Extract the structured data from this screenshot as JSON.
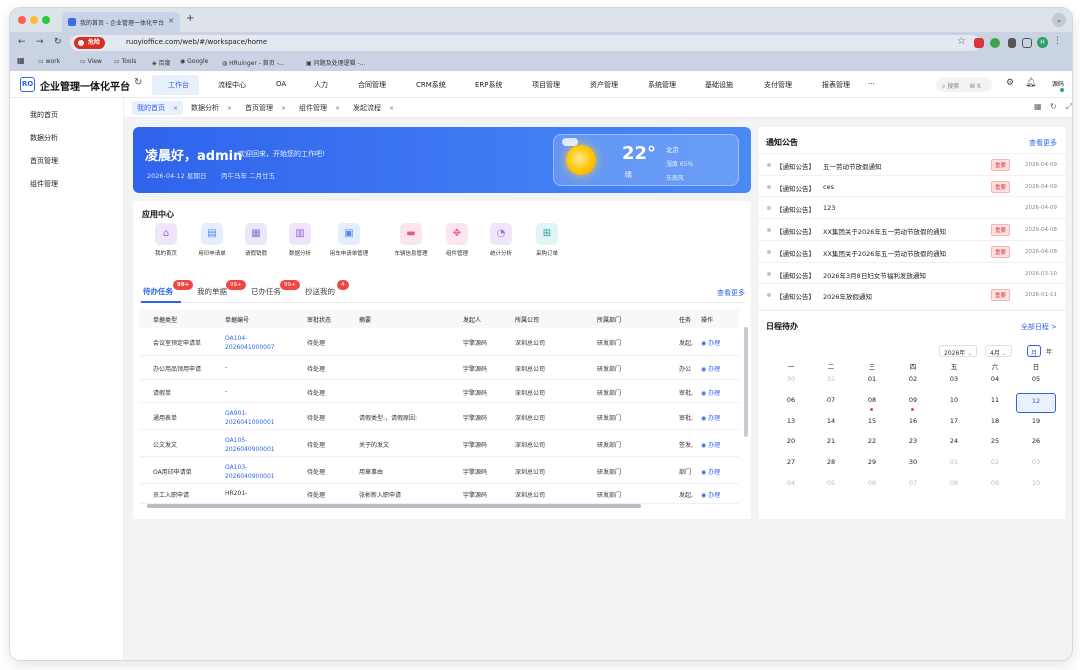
{
  "browser": {
    "tab_title": "我的首页 - 企业管理一体化平台",
    "danger_label": "危险",
    "url": "ruoyioffice.com/web/#/workspace/home",
    "profile_initial": "H",
    "bookmarks": [
      "work",
      "View",
      "Tools",
      "百度",
      "Google",
      "HRuinger - 首页 -...",
      "问题及处理逻辑 -..."
    ]
  },
  "app": {
    "logo": "RO",
    "title": "企业管理一体化平台",
    "nav": [
      "工作台",
      "流程中心",
      "OA",
      "人力",
      "合同管理",
      "CRM系统",
      "ERP系统",
      "项目管理",
      "资产管理",
      "系统管理",
      "基础设施",
      "支付管理",
      "报表管理",
      "···"
    ],
    "search_placeholder": "搜索",
    "search_shortcut": "⌘ K",
    "user": "源码"
  },
  "sidebar": [
    "我的首页",
    "数据分析",
    "首页管理",
    "组件管理"
  ],
  "page_tabs": [
    "我的首页",
    "数据分析",
    "首页管理",
    "组件管理",
    "发起流程"
  ],
  "welcome": {
    "greeting": "凌晨好，admin",
    "message": "欢迎回来，开始您的工作吧!",
    "date": "2026-04-12 星期日",
    "lunar": "丙午马年 二月廿五",
    "temperature": "22°",
    "condition": "晴",
    "city": "北京",
    "humidity": "湿度 65%",
    "wind": "东南风"
  },
  "app_center": {
    "title": "应用中心",
    "items": [
      {
        "label": "我的首页",
        "icon": "home-icon",
        "color": "#9b6be0",
        "bg": "#efe6fb"
      },
      {
        "label": "用印申请单",
        "icon": "document-icon",
        "color": "#4f8ef0",
        "bg": "#e4eefd"
      },
      {
        "label": "请假销假",
        "icon": "calendar-icon",
        "color": "#8b6ed8",
        "bg": "#ece7fa"
      },
      {
        "label": "数据分析",
        "icon": "chart-icon",
        "color": "#9b5fd8",
        "bg": "#efe5fa"
      },
      {
        "label": "用车申请单管理",
        "icon": "form-icon",
        "color": "#4f8ef0",
        "bg": "#e4eefd"
      },
      {
        "label": "车辆信息管理",
        "icon": "car-icon",
        "color": "#e15b8c",
        "bg": "#fce6ee"
      },
      {
        "label": "组件管理",
        "icon": "component-icon",
        "color": "#e2589a",
        "bg": "#fce5f0"
      },
      {
        "label": "统计分析",
        "icon": "pie-icon",
        "color": "#9b6be0",
        "bg": "#efe6fb"
      },
      {
        "label": "采购订单",
        "icon": "grid-icon",
        "color": "#1f9f9a",
        "bg": "#e2f5f4"
      }
    ]
  },
  "tasks": {
    "tabs": [
      {
        "label": "待办任务",
        "badge": "99+"
      },
      {
        "label": "我的单据",
        "badge": "99+"
      },
      {
        "label": "已办任务",
        "badge": "99+"
      },
      {
        "label": "抄送我的",
        "badge": "4"
      }
    ],
    "view_more": "查看更多",
    "columns": [
      "单据类型",
      "单据编号",
      "审批状态",
      "摘要",
      "发起人",
      "所属公司",
      "所属部门",
      "任务",
      "操作"
    ],
    "rows": [
      {
        "type": "会议室预定申请单",
        "no1": "OA104-",
        "no2": "2026041000007",
        "status": "待处理",
        "summary": "",
        "initiator": "宇擎源码",
        "company": "深圳总公司",
        "dept": "研发部门",
        "task": "发起,",
        "op": "◉ 办理"
      },
      {
        "type": "办公用品领用申请",
        "no1": "-",
        "no2": "",
        "status": "待处理",
        "summary": "",
        "initiator": "宇擎源码",
        "company": "深圳总公司",
        "dept": "研发部门",
        "task": "办公",
        "op": "◉ 办理"
      },
      {
        "type": "请假单",
        "no1": "-",
        "no2": "",
        "status": "待处理",
        "summary": "",
        "initiator": "宇擎源码",
        "company": "深圳总公司",
        "dept": "研发部门",
        "task": "审批,",
        "op": "◉ 办理"
      },
      {
        "type": "通用表单",
        "no1": "OA901-",
        "no2": "2026041000001",
        "status": "待处理",
        "summary": "请假类型:，请假原因:",
        "initiator": "宇擎源码",
        "company": "深圳总公司",
        "dept": "研发部门",
        "task": "审批,",
        "op": "◉ 办理"
      },
      {
        "type": "公文发文",
        "no1": "OA105-",
        "no2": "2026040900001",
        "status": "待处理",
        "summary": "关于的发文",
        "initiator": "宇擎源码",
        "company": "深圳总公司",
        "dept": "研发部门",
        "task": "签发,",
        "op": "◉ 办理"
      },
      {
        "type": "OA用印申请单",
        "no1": "OA103-",
        "no2": "2026040900001",
        "status": "待处理",
        "summary": "用章事由",
        "initiator": "宇擎源码",
        "company": "深圳总公司",
        "dept": "研发部门",
        "task": "部门",
        "op": "◉ 办理"
      },
      {
        "type": "员工入职申请",
        "no1": "HR201-",
        "no2": "",
        "status": "待处理",
        "summary": "张彬新入职申请",
        "initiator": "宇擎源码",
        "company": "深圳总公司",
        "dept": "研发部门",
        "task": "发起,",
        "op": "◉ 办理"
      }
    ]
  },
  "notices": {
    "title": "通知公告",
    "view_more": "查看更多",
    "items": [
      {
        "category": "【通知公告】",
        "text": "五一劳动节放假通知",
        "important": "重要",
        "date": "2026-04-09"
      },
      {
        "category": "【通知公告】",
        "text": "ces",
        "important": "重要",
        "date": "2026-04-09"
      },
      {
        "category": "【通知公告】",
        "text": "123",
        "important": "",
        "date": "2026-04-09"
      },
      {
        "category": "【通知公告】",
        "text": "XX集团关于2026年五一劳动节放假的通知",
        "important": "重要",
        "date": "2026-04-08"
      },
      {
        "category": "【通知公告】",
        "text": "XX集团关于2026年五一劳动节放假的通知",
        "important": "重要",
        "date": "2026-04-08"
      },
      {
        "category": "【通知公告】",
        "text": "2026年3月8日妇女节福利发放通知",
        "important": "",
        "date": "2026-03-10"
      },
      {
        "category": "【通知公告】",
        "text": "2026年放假通知",
        "important": "重要",
        "date": "2026-01-11"
      }
    ]
  },
  "calendar": {
    "title": "日程待办",
    "view_all": "全部日程 >",
    "year": "2026年",
    "month": "4月",
    "btn_month": "月",
    "btn_year": "年",
    "weekdays": [
      "一",
      "二",
      "三",
      "四",
      "五",
      "六",
      "日"
    ],
    "weeks": [
      [
        "30",
        "31",
        "01",
        "02",
        "03",
        "04",
        "05"
      ],
      [
        "06",
        "07",
        "08",
        "09",
        "10",
        "11",
        "12"
      ],
      [
        "13",
        "14",
        "15",
        "16",
        "17",
        "18",
        "19"
      ],
      [
        "20",
        "21",
        "22",
        "23",
        "24",
        "25",
        "26"
      ],
      [
        "27",
        "28",
        "29",
        "30",
        "01",
        "02",
        "03"
      ],
      [
        "04",
        "05",
        "06",
        "07",
        "08",
        "09",
        "10"
      ]
    ],
    "selected": "12",
    "event_days": [
      "08",
      "09"
    ]
  }
}
